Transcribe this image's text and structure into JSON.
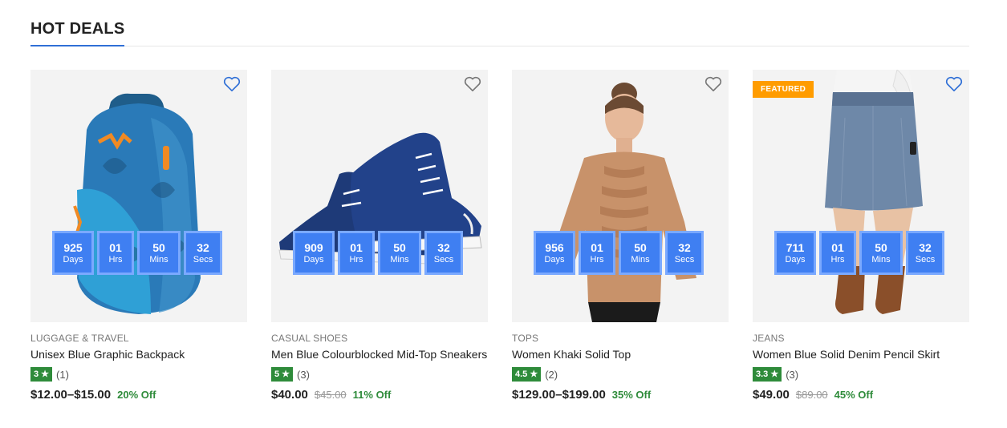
{
  "section": {
    "title": "HOT DEALS"
  },
  "colors": {
    "accent": "#2f6fd6",
    "countdown": "#3f7ff2",
    "rating": "#2e8b3a",
    "featured": "#ff9c00"
  },
  "labels": {
    "days": "Days",
    "hrs": "Hrs",
    "mins": "Mins",
    "secs": "Secs"
  },
  "products": [
    {
      "image": "blue-backpack",
      "category": "LUGGAGE & TRAVEL",
      "title": "Unisex Blue Graphic Backpack",
      "rating": "3 ★",
      "reviews": "(1)",
      "price": "$12.00–$15.00",
      "old_price": "",
      "discount": "20% Off",
      "countdown": {
        "days": "925",
        "hrs": "01",
        "mins": "50",
        "secs": "32"
      },
      "featured": ""
    },
    {
      "image": "navy-sneakers",
      "category": "CASUAL SHOES",
      "title": "Men Blue Colourblocked Mid-Top Sneakers",
      "rating": "5 ★",
      "reviews": "(3)",
      "price": "$40.00",
      "old_price": "$45.00",
      "discount": "11% Off",
      "countdown": {
        "days": "909",
        "hrs": "01",
        "mins": "50",
        "secs": "32"
      },
      "featured": ""
    },
    {
      "image": "khaki-top",
      "category": "TOPS",
      "title": "Women Khaki Solid Top",
      "rating": "4.5 ★",
      "reviews": "(2)",
      "price": "$129.00–$199.00",
      "old_price": "",
      "discount": "35% Off",
      "countdown": {
        "days": "956",
        "hrs": "01",
        "mins": "50",
        "secs": "32"
      },
      "featured": ""
    },
    {
      "image": "denim-skirt",
      "category": "JEANS",
      "title": "Women Blue Solid Denim Pencil Skirt",
      "rating": "3.3 ★",
      "reviews": "(3)",
      "price": "$49.00",
      "old_price": "$89.00",
      "discount": "45% Off",
      "countdown": {
        "days": "711",
        "hrs": "01",
        "mins": "50",
        "secs": "32"
      },
      "featured": "FEATURED"
    }
  ]
}
